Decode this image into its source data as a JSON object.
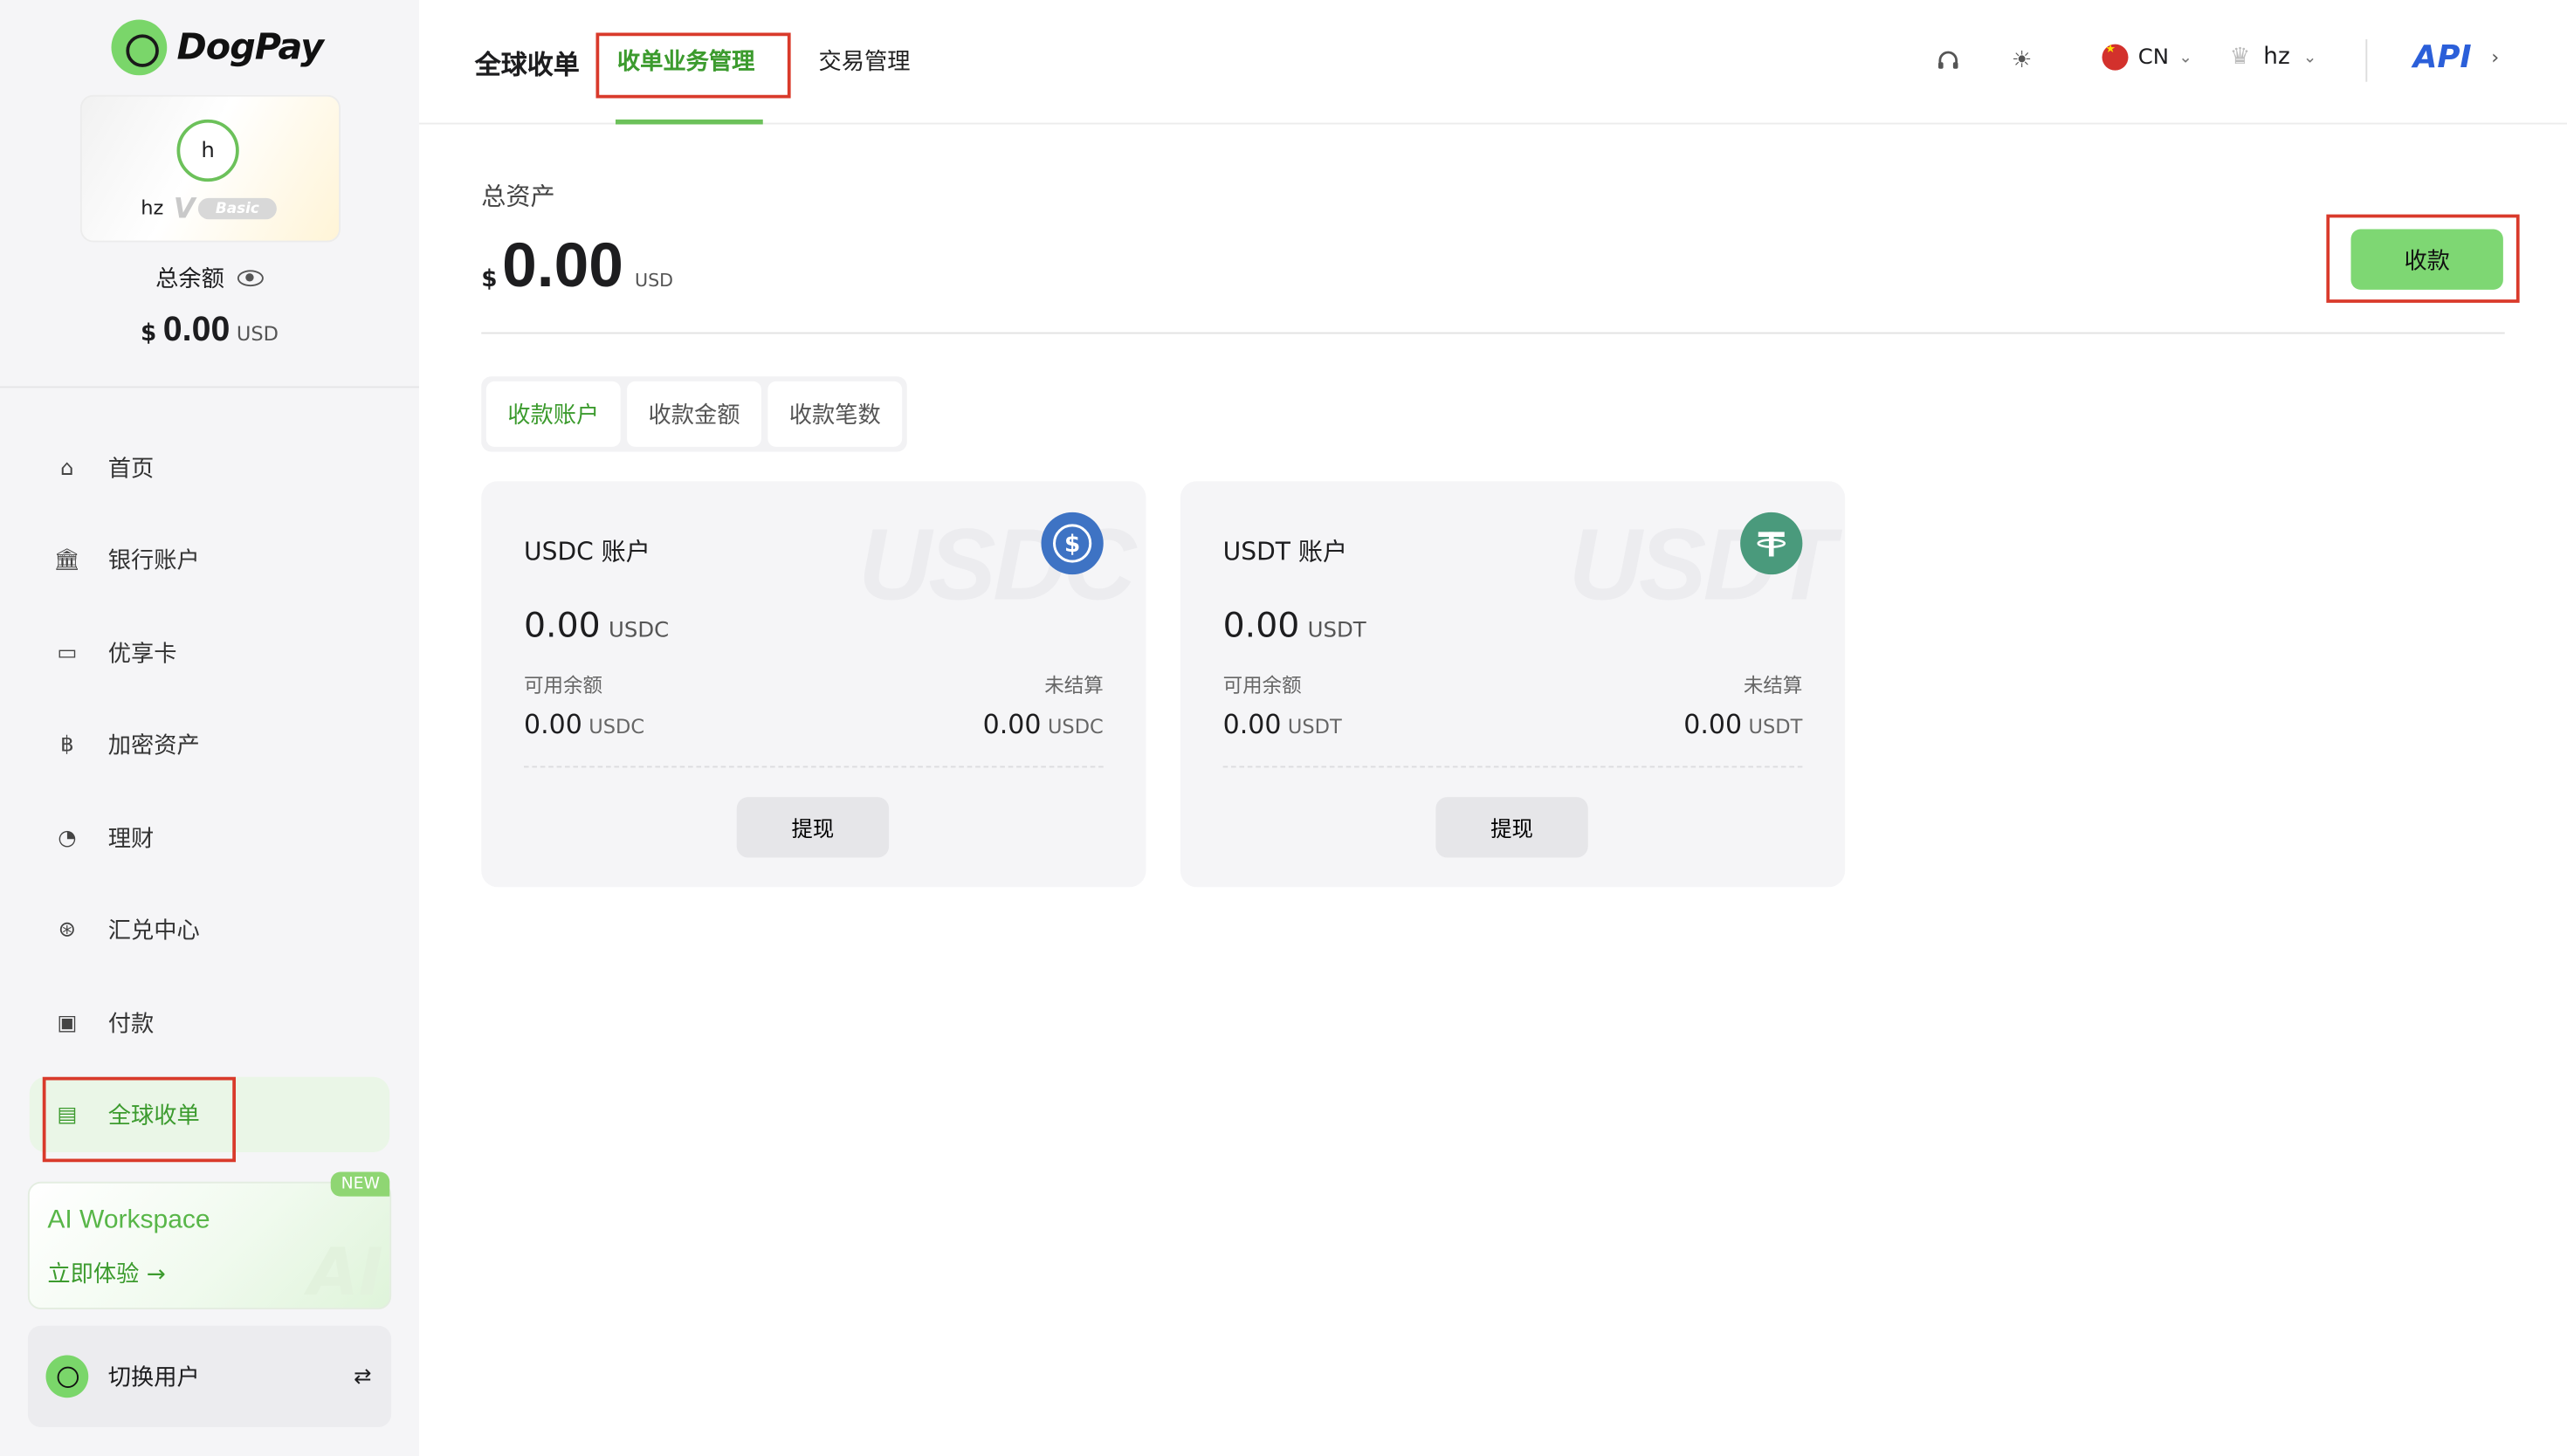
{
  "brand": {
    "name": "DogPay"
  },
  "profile": {
    "avatar_letter": "h",
    "username": "hz",
    "tier_letter": "V",
    "tier": "Basic"
  },
  "balance": {
    "label": "总余额",
    "currency_symbol": "$",
    "amount": "0.00",
    "unit": "USD"
  },
  "sidebar": {
    "items": [
      {
        "label": "首页",
        "icon": "home-icon"
      },
      {
        "label": "银行账户",
        "icon": "bank-icon"
      },
      {
        "label": "优享卡",
        "icon": "card-icon"
      },
      {
        "label": "加密资产",
        "icon": "bitcoin-icon"
      },
      {
        "label": "理财",
        "icon": "wealth-icon"
      },
      {
        "label": "汇兑中心",
        "icon": "exchange-icon"
      },
      {
        "label": "付款",
        "icon": "wallet-icon"
      },
      {
        "label": "全球收单",
        "icon": "receipt-icon",
        "active": true
      }
    ],
    "ai_card": {
      "title": "AI Workspace",
      "cta": "立即体验",
      "cta_arrow": "→",
      "badge": "NEW",
      "watermark": "AI"
    },
    "switch_user": {
      "label": "切换用户",
      "icon": "swap-icon"
    }
  },
  "header": {
    "title": "全球收单",
    "tabs": [
      {
        "label": "收单业务管理",
        "active": true
      },
      {
        "label": "交易管理",
        "active": false
      }
    ],
    "language": "CN",
    "user": "hz",
    "api": "API"
  },
  "main": {
    "asset_label": "总资产",
    "currency_symbol": "$",
    "asset_amount": "0.00",
    "asset_unit": "USD",
    "collect_button": "收款",
    "segments": [
      {
        "label": "收款账户",
        "active": true
      },
      {
        "label": "收款金额",
        "active": false
      },
      {
        "label": "收款笔数",
        "active": false
      }
    ],
    "accounts": [
      {
        "name": "USDC 账户",
        "watermark": "USDC",
        "coin_icon": "usdc-icon",
        "coin_color": "#3e73c4",
        "amount": "0.00",
        "unit": "USDC",
        "available_label": "可用余额",
        "available": "0.00",
        "unsettled_label": "未结算",
        "unsettled": "0.00",
        "withdraw": "提现"
      },
      {
        "name": "USDT 账户",
        "watermark": "USDT",
        "coin_icon": "usdt-icon",
        "coin_color": "#4a9a7c",
        "amount": "0.00",
        "unit": "USDT",
        "available_label": "可用余额",
        "available": "0.00",
        "unsettled_label": "未结算",
        "unsettled": "0.00",
        "withdraw": "提现"
      }
    ]
  },
  "colors": {
    "accent": "#6cc15a",
    "accent_text": "#3c9b2e",
    "highlight_box": "#d93a2b",
    "api": "#2b5fd9"
  }
}
